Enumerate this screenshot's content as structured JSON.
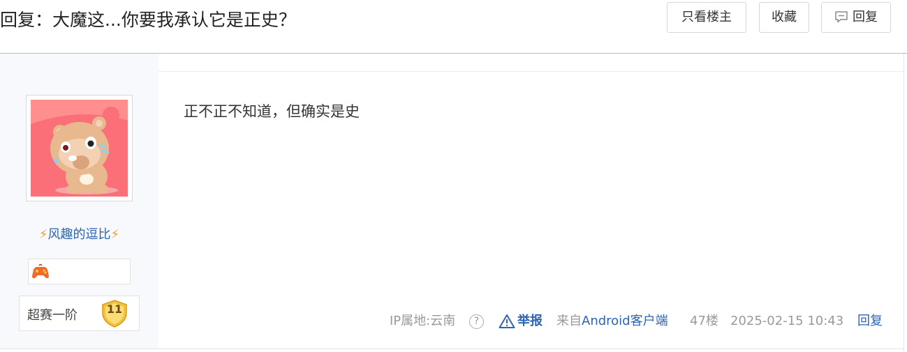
{
  "header": {
    "title": "回复：大魔这...你要我承认它是正史？",
    "buttons": {
      "only_owner": "只看楼主",
      "favorite": "收藏",
      "reply": "回复"
    }
  },
  "post": {
    "author": {
      "username": "风趣的逗比",
      "username_decoration": "⚡",
      "level_name": "超赛一阶",
      "level_number": "11"
    },
    "content": "正不正不知道，但确实是史",
    "tail": {
      "ip_location": "IP属地:云南",
      "help": "?",
      "report": "举报",
      "from_prefix": "来自",
      "client": "Android客户端",
      "floor": "47楼",
      "time": "2025-02-15 10:43",
      "reply": "回复"
    }
  },
  "colors": {
    "link": "#2d64b3",
    "muted": "#999999",
    "sidebar_bg": "#f8f9fc"
  }
}
